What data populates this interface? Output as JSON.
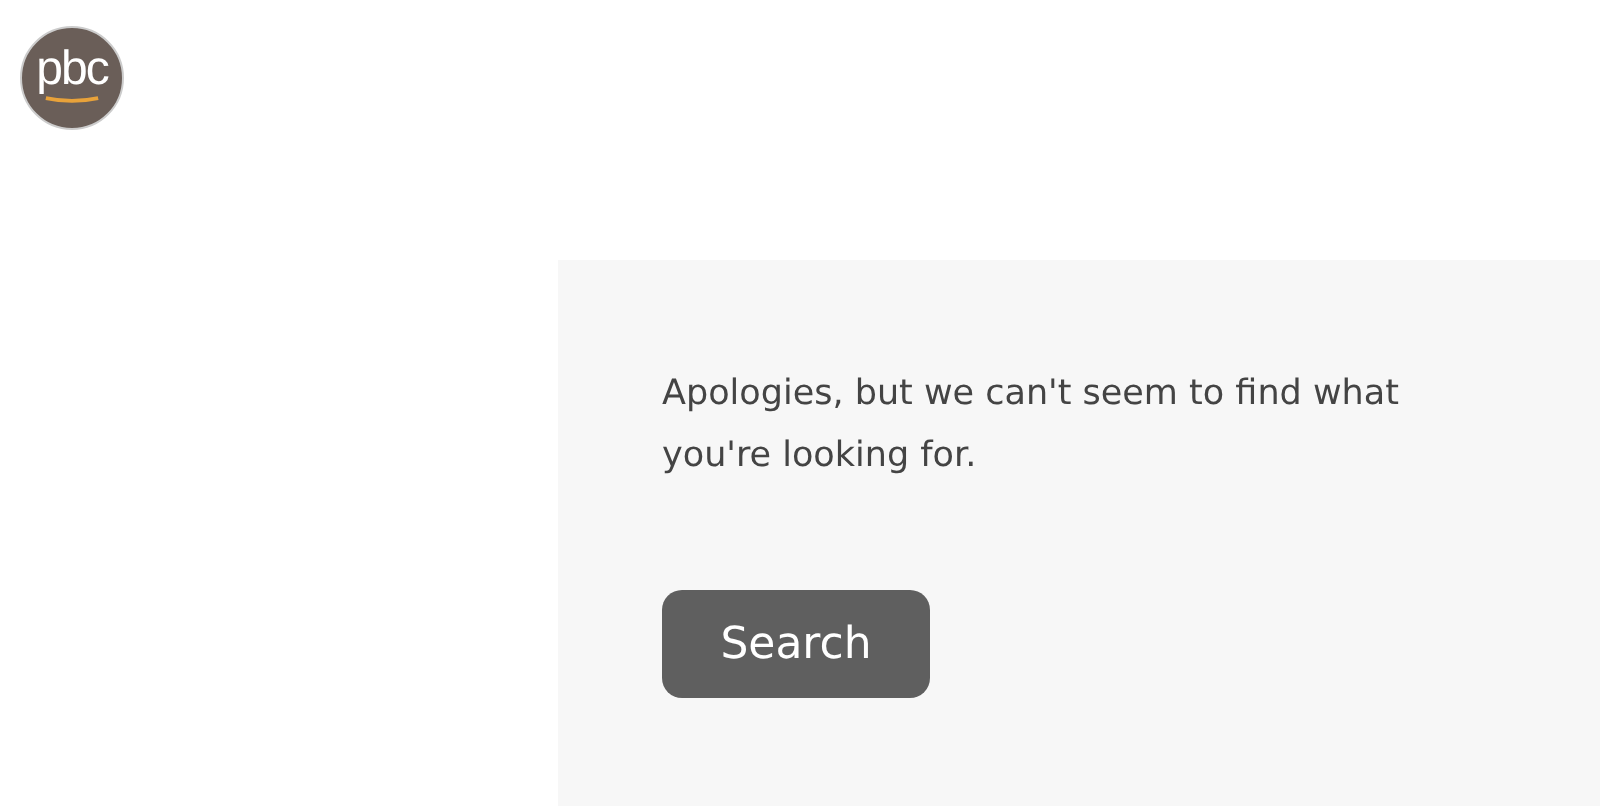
{
  "logo": {
    "text": "pbc"
  },
  "message": "Apologies, but we can't seem to find what you're looking for.",
  "search_button": {
    "label": "Search"
  }
}
